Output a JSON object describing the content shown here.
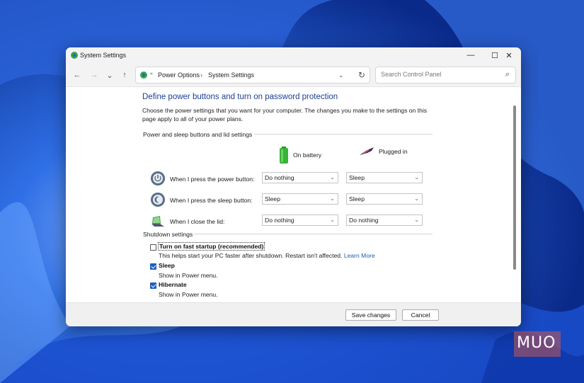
{
  "window": {
    "title": "System Settings"
  },
  "titlebar": {
    "minimize_label": "—",
    "maximize_label": "☐",
    "close_label": "✕"
  },
  "nav": {
    "back": "←",
    "forward": "→",
    "recent": "⌄",
    "up": "↑",
    "breadcrumb_sep": "«",
    "breadcrumb": [
      "Power Options",
      "System Settings"
    ],
    "breadcrumb_arrow": "›",
    "address_dropdown": "⌄",
    "refresh": "↻"
  },
  "search": {
    "placeholder": "Search Control Panel",
    "icon": "⌕"
  },
  "main": {
    "heading": "Define power buttons and turn on password protection",
    "description": "Choose the power settings that you want for your computer. The changes you make to the settings on this page apply to all of your power plans.",
    "section_buttons": "Power and sleep buttons and lid settings",
    "col_battery": "On battery",
    "col_plugged": "Plugged in",
    "rows": [
      {
        "label": "When I press the power button:",
        "battery": "Do nothing",
        "plugged": "Sleep"
      },
      {
        "label": "When I press the sleep button:",
        "battery": "Sleep",
        "plugged": "Sleep"
      },
      {
        "label": "When I close the lid:",
        "battery": "Do nothing",
        "plugged": "Do nothing"
      }
    ],
    "section_shutdown": "Shutdown settings",
    "shutdown": [
      {
        "label": "Turn on fast startup (recommended)",
        "desc": "This helps start your PC faster after shutdown. Restart isn't affected.",
        "link": "Learn More",
        "checked": false
      },
      {
        "label": "Sleep",
        "desc": "Show in Power menu.",
        "checked": true
      },
      {
        "label": "Hibernate",
        "desc": "Show in Power menu.",
        "checked": true
      }
    ]
  },
  "footer": {
    "save": "Save changes",
    "cancel": "Cancel"
  },
  "watermark": "MUO",
  "colors": {
    "heading": "#1c3f94",
    "checkbox_checked": "#1e5fc2",
    "link": "#1a5fb4"
  }
}
